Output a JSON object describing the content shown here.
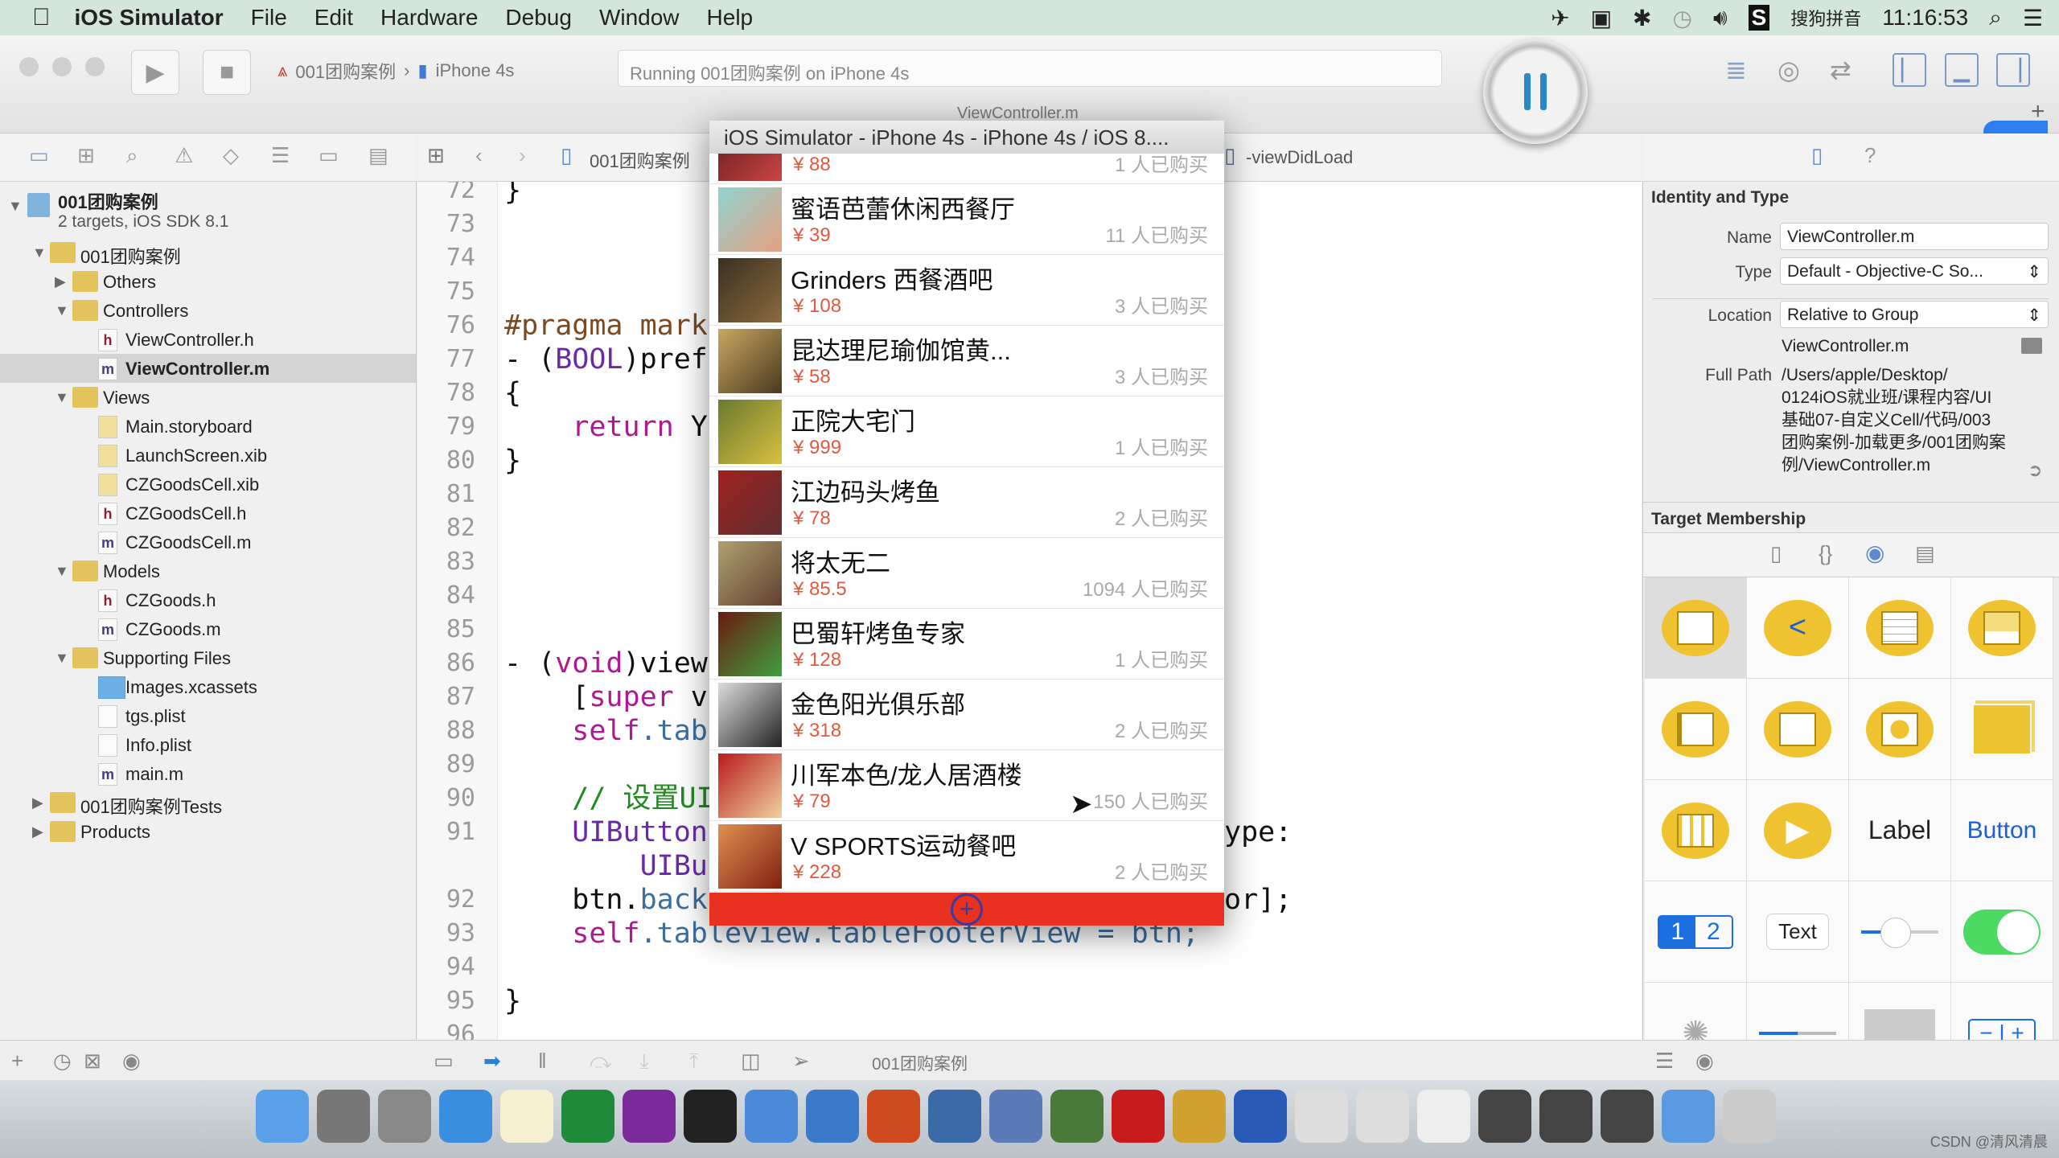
{
  "menubar": {
    "app": "iOS Simulator",
    "items": [
      "File",
      "Edit",
      "Hardware",
      "Debug",
      "Window",
      "Help"
    ],
    "input_method": "搜狗拼音",
    "clock": "11:16:53"
  },
  "toolbar": {
    "scheme": "001团购案例",
    "device": "iPhone 4s",
    "status": "Running 001团购案例 on iPhone 4s",
    "tab_title": "ViewController.m"
  },
  "jumpbar": {
    "file": "001团购案例",
    "method": "-viewDidLoad"
  },
  "sidebar": {
    "items": [
      {
        "label": "001团购案例",
        "sub": "2 targets, iOS SDK 8.1",
        "level": 0,
        "kind": "project",
        "expanded": true
      },
      {
        "label": "001团购案例",
        "level": 1,
        "kind": "folder",
        "expanded": true
      },
      {
        "label": "Others",
        "level": 2,
        "kind": "folder",
        "expanded": false
      },
      {
        "label": "Controllers",
        "level": 2,
        "kind": "folder",
        "expanded": true
      },
      {
        "label": "ViewController.h",
        "level": 3,
        "kind": "h"
      },
      {
        "label": "ViewController.m",
        "level": 3,
        "kind": "m",
        "selected": true
      },
      {
        "label": "Views",
        "level": 2,
        "kind": "folder",
        "expanded": true
      },
      {
        "label": "Main.storyboard",
        "level": 3,
        "kind": "storyboard"
      },
      {
        "label": "LaunchScreen.xib",
        "level": 3,
        "kind": "xib"
      },
      {
        "label": "CZGoodsCell.xib",
        "level": 3,
        "kind": "xib"
      },
      {
        "label": "CZGoodsCell.h",
        "level": 3,
        "kind": "h"
      },
      {
        "label": "CZGoodsCell.m",
        "level": 3,
        "kind": "m"
      },
      {
        "label": "Models",
        "level": 2,
        "kind": "folder",
        "expanded": true
      },
      {
        "label": "CZGoods.h",
        "level": 3,
        "kind": "h"
      },
      {
        "label": "CZGoods.m",
        "level": 3,
        "kind": "m"
      },
      {
        "label": "Supporting Files",
        "level": 2,
        "kind": "folder",
        "expanded": true
      },
      {
        "label": "Images.xcassets",
        "level": 3,
        "kind": "xcassets"
      },
      {
        "label": "tgs.plist",
        "level": 3,
        "kind": "plist"
      },
      {
        "label": "Info.plist",
        "level": 3,
        "kind": "plist"
      },
      {
        "label": "main.m",
        "level": 3,
        "kind": "m"
      },
      {
        "label": "001团购案例Tests",
        "level": 1,
        "kind": "folder",
        "expanded": false
      },
      {
        "label": "Products",
        "level": 1,
        "kind": "folder",
        "expanded": false
      }
    ]
  },
  "editor": {
    "lines": [
      {
        "n": "72",
        "left": [
          [
            "}",
            "plain"
          ]
        ]
      },
      {
        "n": "73",
        "left": []
      },
      {
        "n": "74",
        "left": []
      },
      {
        "n": "75",
        "left": []
      },
      {
        "n": "76",
        "left": [
          [
            "#pragma mark",
            "pre"
          ]
        ]
      },
      {
        "n": "77",
        "left": [
          [
            "- (",
            "plain"
          ],
          [
            "BOOL",
            "type"
          ],
          [
            ")pref",
            "plain"
          ]
        ]
      },
      {
        "n": "78",
        "left": [
          [
            "{",
            "plain"
          ]
        ]
      },
      {
        "n": "79",
        "left": [
          [
            "    ",
            "plain"
          ],
          [
            "return",
            "kw"
          ],
          [
            " Y",
            "plain"
          ]
        ]
      },
      {
        "n": "80",
        "left": [
          [
            "}",
            "plain"
          ]
        ]
      },
      {
        "n": "81",
        "left": []
      },
      {
        "n": "82",
        "left": []
      },
      {
        "n": "83",
        "left": []
      },
      {
        "n": "84",
        "left": []
      },
      {
        "n": "85",
        "left": []
      },
      {
        "n": "86",
        "left": [
          [
            "- (",
            "plain"
          ],
          [
            "void",
            "kw"
          ],
          [
            ")view",
            "plain"
          ]
        ]
      },
      {
        "n": "87",
        "left": [
          [
            "    [",
            "plain"
          ],
          [
            "super",
            "kw"
          ],
          [
            " v",
            "plain"
          ]
        ]
      },
      {
        "n": "88",
        "left": [
          [
            "    ",
            "plain"
          ],
          [
            "self",
            "kw"
          ],
          [
            ".tab",
            "id"
          ]
        ]
      },
      {
        "n": "89",
        "left": []
      },
      {
        "n": "90",
        "left": [
          [
            "    // 设置UI",
            "cm"
          ]
        ]
      },
      {
        "n": "91",
        "left": [
          [
            "    ",
            "plain"
          ],
          [
            "UIButton",
            "type"
          ]
        ],
        "right": [
          [
            "ype:",
            "plain"
          ]
        ]
      },
      {
        "n": "",
        "left": [
          [
            "        ",
            "plain"
          ],
          [
            "UIBu",
            "type"
          ]
        ]
      },
      {
        "n": "92",
        "left": [
          [
            "    btn.",
            "plain"
          ],
          [
            "back",
            "id"
          ]
        ],
        "right": [
          [
            "or];",
            "plain"
          ]
        ]
      },
      {
        "n": "93",
        "left": [
          [
            "    ",
            "plain"
          ],
          [
            "self",
            "kw"
          ],
          [
            ".tableview.tableFooterView = btn;",
            "id"
          ]
        ]
      },
      {
        "n": "94",
        "left": []
      },
      {
        "n": "95",
        "left": [
          [
            "}",
            "plain"
          ]
        ]
      },
      {
        "n": "96",
        "left": []
      }
    ]
  },
  "simulator": {
    "title": "iOS Simulator - iPhone 4s - iPhone 4s / iOS 8....",
    "footer_icon": "plus-circle-icon",
    "rows": [
      {
        "name": "",
        "price": "¥ 88",
        "count": "1 人已购买"
      },
      {
        "name": "蜜语芭蕾休闲西餐厅",
        "price": "¥ 39",
        "count": "11 人已购买"
      },
      {
        "name": "Grinders 西餐酒吧",
        "price": "¥ 108",
        "count": "3 人已购买"
      },
      {
        "name": "昆达理尼瑜伽馆黄...",
        "price": "¥ 58",
        "count": "3 人已购买"
      },
      {
        "name": "正院大宅门",
        "price": "¥ 999",
        "count": "1 人已购买"
      },
      {
        "name": "江边码头烤鱼",
        "price": "¥ 78",
        "count": "2 人已购买"
      },
      {
        "name": "将太无二",
        "price": "¥ 85.5",
        "count": "1094 人已购买"
      },
      {
        "name": "巴蜀轩烤鱼专家",
        "price": "¥ 128",
        "count": "1 人已购买"
      },
      {
        "name": "金色阳光俱乐部",
        "price": "¥ 318",
        "count": "2 人已购买"
      },
      {
        "name": "川军本色/龙人居酒楼",
        "price": "¥ 79",
        "count": "150 人已购买"
      },
      {
        "name": "V SPORTS运动餐吧",
        "price": "¥ 228",
        "count": "2 人已购买"
      }
    ]
  },
  "inspector": {
    "identity_title": "Identity and Type",
    "name_label": "Name",
    "name_value": "ViewController.m",
    "type_label": "Type",
    "type_value": "Default - Objective-C So...",
    "location_label": "Location",
    "location_value": "Relative to Group",
    "location_file": "ViewController.m",
    "fullpath_label": "Full Path",
    "fullpath_lines": [
      "/Users/apple/Desktop/",
      "0124iOS就业班/课程内容/UI",
      "基础07-自定义Cell/代码/003",
      "团购案例-加载更多/001团购案",
      "例/ViewController.m"
    ],
    "target_title": "Target Membership",
    "library": {
      "label": "Label",
      "button": "Button",
      "seg1": "1",
      "seg2": "2",
      "text": "Text"
    }
  },
  "debugbar": {
    "target": "001团购案例"
  },
  "watermark": "CSDN @清风清晨",
  "colors": {
    "accent": "#2a88c8",
    "footer_red": "#e8321f",
    "price": "#e05a40",
    "folder": "#e3c45c"
  }
}
